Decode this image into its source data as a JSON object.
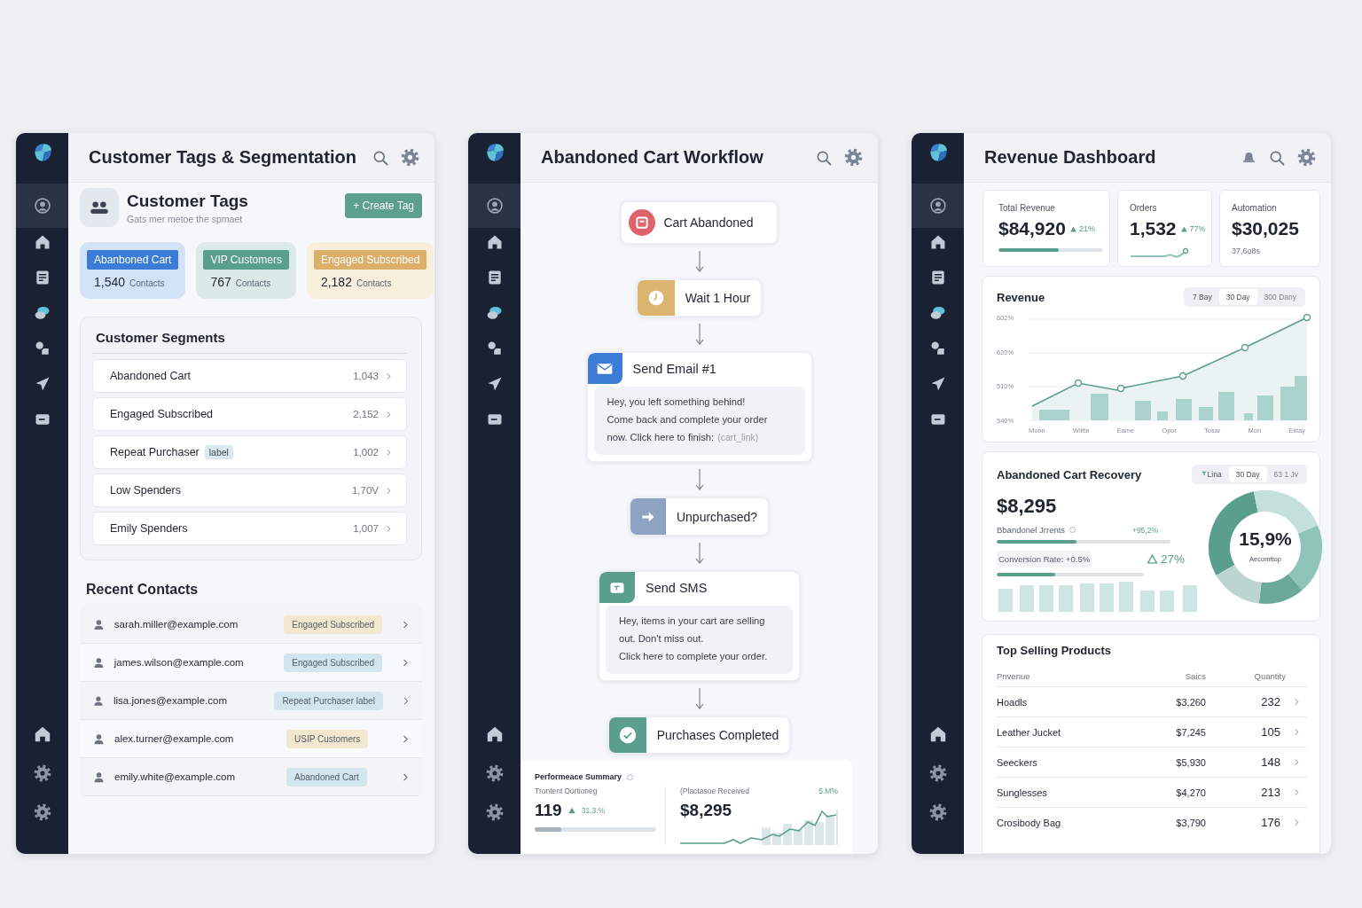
{
  "tags_window": {
    "title": "Customer Tags & Segmentation",
    "sidebar": {
      "items": [
        {
          "selected": true
        },
        {
          "selected": false
        },
        {
          "selected": false
        },
        {
          "selected": false
        },
        {
          "selected": false
        },
        {
          "selected": false
        },
        {
          "selected": false
        }
      ]
    },
    "header": {
      "title": "Customer Tags",
      "subtitle": "Gats mer metoe the spmaet",
      "button": "+ Create Tag"
    },
    "tag_cards": [
      {
        "label": "Abanboned Cart",
        "count": "1,540",
        "unit": "Contacts",
        "color": "#3b7dd6"
      },
      {
        "label": "VIP Customers",
        "count": "767",
        "unit": "Contacts",
        "color": "#5a9e8c"
      },
      {
        "label": "Engaged Subscribed",
        "count": "2,182",
        "unit": "Contacts",
        "color": "#dcb06a"
      }
    ],
    "segments": {
      "title": "Customer Segments",
      "rows": [
        {
          "name": "Abandoned Cart",
          "count": "1,043"
        },
        {
          "name": "Engaged Subscribed",
          "count": "2,152"
        },
        {
          "name": "Repeat Purchaser",
          "badge": "label",
          "count": "1,002"
        },
        {
          "name": "Low Spenders",
          "count": "1,70V"
        },
        {
          "name": "Emily Spenders",
          "count": "1,007"
        }
      ]
    },
    "recent_contacts": {
      "title": "Recent Contacts",
      "rows": [
        {
          "email": "sarah.miller@example.com",
          "tag": "Engaged Subscribed",
          "color": "#f3e8cf"
        },
        {
          "email": "james.wilson@example.com",
          "tag": "Engaged Subscribed",
          "color": "#d3e6ef"
        },
        {
          "email": "lisa.jones@example.com",
          "tag": "Repeat Purchaser label",
          "color": "#d3e6ef"
        },
        {
          "email": "alex.turner@example.com",
          "tag": "USIP Customers",
          "color": "#f3e8cf"
        },
        {
          "email": "emily.white@example.com",
          "tag": "Abandoned Cart",
          "color": "#d3e6ef"
        }
      ]
    }
  },
  "workflow_window": {
    "title": "Abandoned Cart Workflow",
    "sidebar": {
      "items": [
        {
          "selected": true
        },
        {
          "selected": false
        },
        {
          "selected": false
        },
        {
          "selected": false
        },
        {
          "selected": false
        },
        {
          "selected": false
        },
        {
          "selected": false
        }
      ]
    },
    "steps": [
      {
        "kind": "trigger",
        "title": "Cart Abandoned"
      },
      {
        "kind": "wait",
        "title": "Wait 1 Hour"
      },
      {
        "kind": "email",
        "title": "Send Email #1",
        "lines": [
          "Hey, you left something behind!",
          "Come back and complete your order",
          "now. Click here to finish:"
        ],
        "link": "(cart_link)"
      },
      {
        "kind": "condition",
        "title": "Unpurchased?"
      },
      {
        "kind": "sms",
        "title": "Send SMS",
        "lines": [
          "Hey, items in your cart are selling",
          "out. Don't miss out.",
          "Click here to complete your order."
        ]
      },
      {
        "kind": "done",
        "title": "Purchases Completed"
      }
    ],
    "summary": {
      "title": "Performeace Summary",
      "left": {
        "label": "Trontent Dortioneg",
        "value": "119",
        "change": "31.3.%",
        "level": 0.22
      },
      "right": {
        "label": "(Plactasoe Received",
        "value": "$8,295",
        "change": "5.M%"
      }
    }
  },
  "revenue_window": {
    "title": "Revenue Dashboard",
    "sidebar": {
      "items": [
        {
          "selected": true
        },
        {
          "selected": false
        },
        {
          "selected": false
        },
        {
          "selected": false
        },
        {
          "selected": false
        },
        {
          "selected": false
        },
        {
          "selected": false
        }
      ]
    },
    "kpis": [
      {
        "kind": "progress",
        "label": "Total Revenue",
        "value": "$84,920",
        "change": "21%",
        "level": 0.58
      },
      {
        "kind": "sparkline",
        "label": "Orders",
        "value": "1,532",
        "change": "77%"
      },
      {
        "kind": "note",
        "label": "Automation",
        "value": "$30,025",
        "note": "37,6o8s"
      }
    ],
    "revenue_chart": {
      "title": "Revenue",
      "periods": [
        {
          "label": "7 Bay",
          "selected": false
        },
        {
          "label": "30 Day",
          "selected": true
        },
        {
          "label": "300 Dany",
          "selected": false
        }
      ],
      "y_labels": [
        "602%",
        "620%",
        "510%",
        "540%"
      ],
      "x_labels": [
        "Monn",
        "Wiltte",
        "Eame",
        "Opor",
        "Tosar",
        "Mon",
        "Eirlay"
      ]
    },
    "recovery": {
      "title": "Abandoned Cart Recovery",
      "periods": [
        {
          "label": "Lina",
          "selected": false
        },
        {
          "label": "30 Day",
          "selected": true
        },
        {
          "label": "63 1 Jv",
          "selected": false
        }
      ],
      "value": "$8,295",
      "metric": {
        "label": "Bbandonel Jrrents",
        "change": "+95,2%",
        "level": 0.46
      },
      "conversion": {
        "label": "Conversion Rate: +0.5%",
        "change": "27%",
        "level": 0.4
      },
      "donut": {
        "value": "15,9%",
        "label": "Aecomttop"
      }
    },
    "products": {
      "title": "Top Selling Products",
      "columns": [
        "Pnvenue",
        "Saics",
        "Quantity"
      ],
      "rows": [
        [
          "Hoadls",
          "$3,260",
          "232"
        ],
        [
          "Leather Jucket",
          "$7,245",
          "105"
        ],
        [
          "Seeckers",
          "$5,930",
          "148"
        ],
        [
          "Sunglesses",
          "$4,270",
          "213"
        ],
        [
          "Crosibody Bag",
          "$3,790",
          "176"
        ]
      ]
    }
  }
}
